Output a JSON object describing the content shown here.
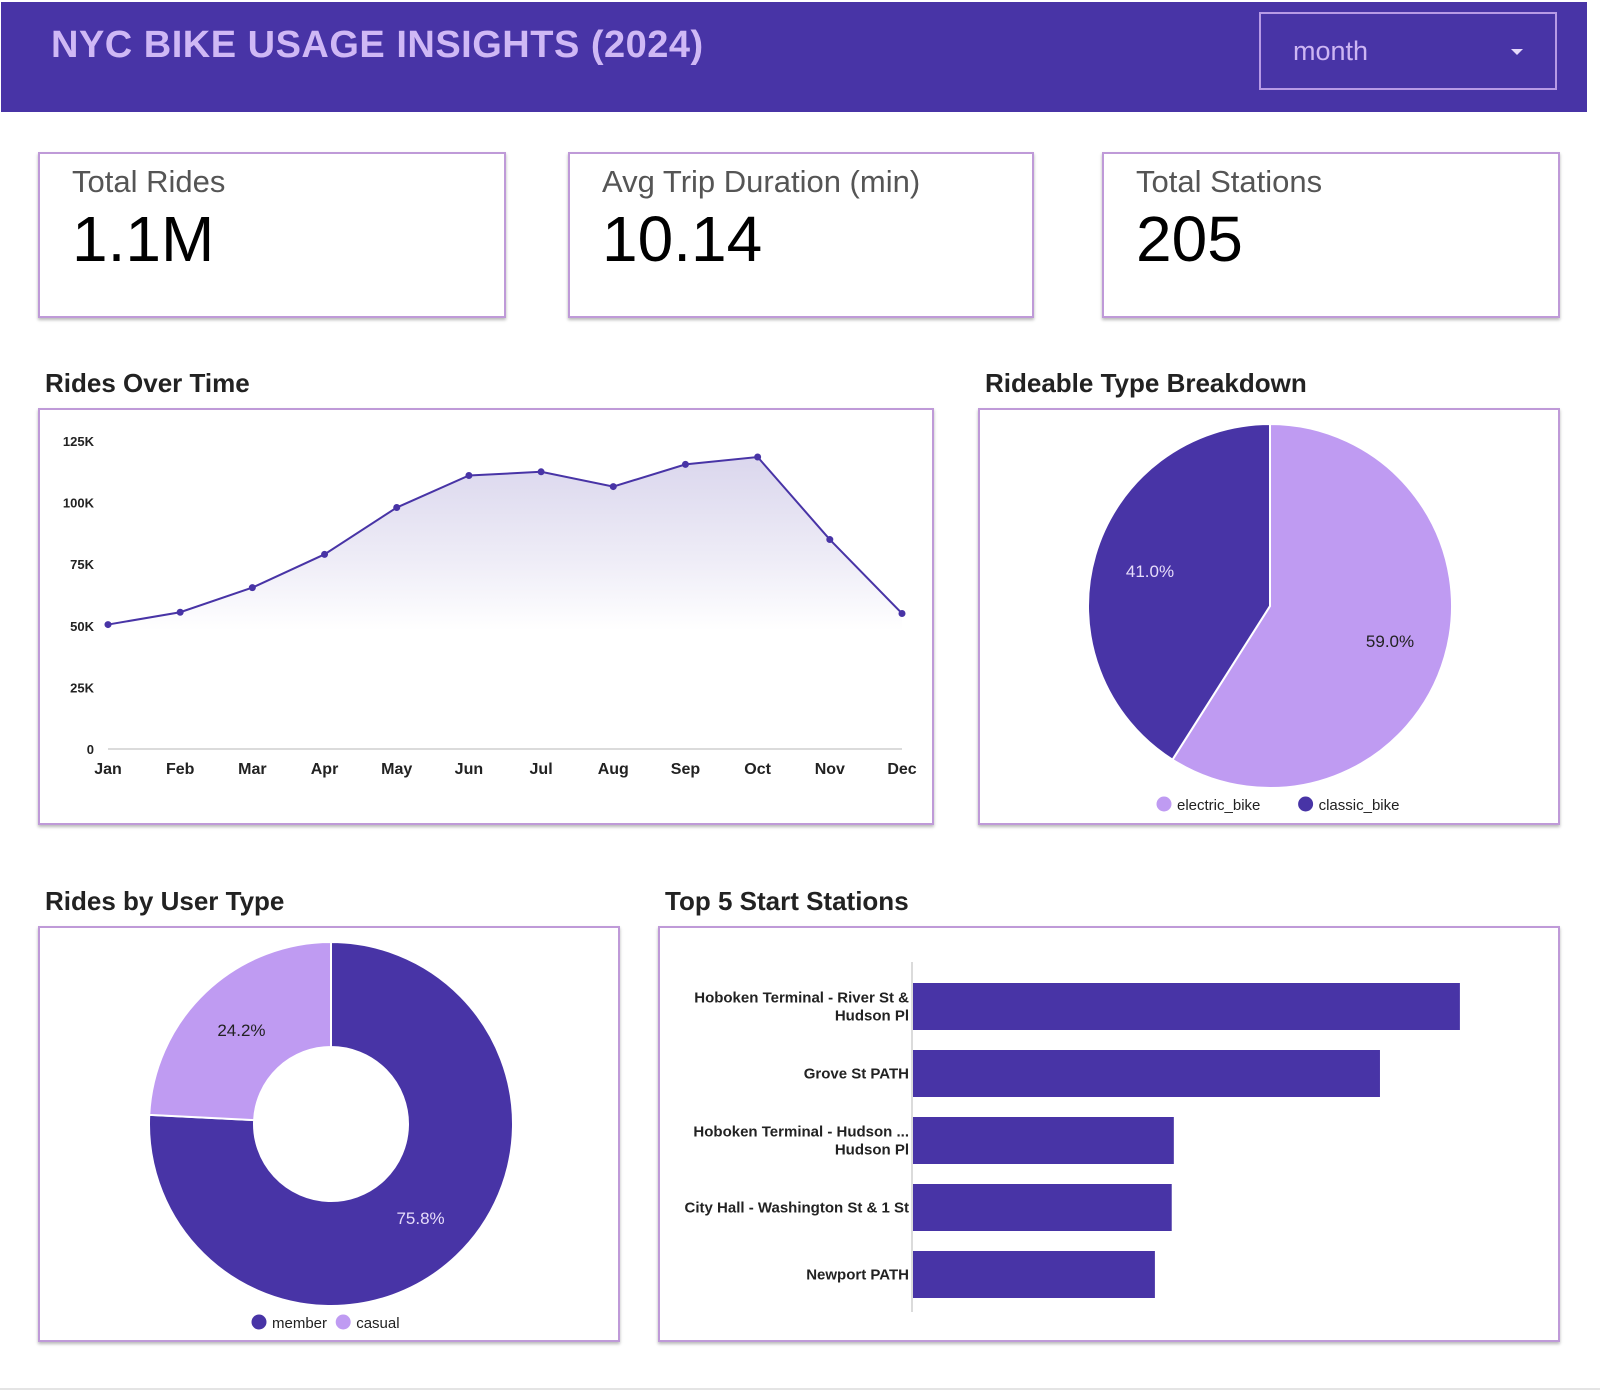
{
  "header": {
    "title": "NYC BIKE USAGE INSIGHTS (2024)",
    "period_select": {
      "value": "month"
    }
  },
  "kpis": [
    {
      "label": "Total Rides",
      "value": "1.1M"
    },
    {
      "label": "Avg Trip Duration (min)",
      "value": "10.14"
    },
    {
      "label": "Total Stations",
      "value": "205"
    }
  ],
  "sections": {
    "rides_over_time": "Rides Over Time",
    "rideable_type": "Rideable Type Breakdown",
    "user_type": "Rides by User Type",
    "top_stations": "Top 5 Start Stations"
  },
  "colors": {
    "primary": "#4834a6",
    "light": "#bf9bf2",
    "title_text": "#cfb8f5",
    "card_border": "#bf9ad8"
  },
  "chart_data": [
    {
      "type": "area",
      "title": "Rides Over Time",
      "categories": [
        "Jan",
        "Feb",
        "Mar",
        "Apr",
        "May",
        "Jun",
        "Jul",
        "Aug",
        "Sep",
        "Oct",
        "Nov",
        "Dec"
      ],
      "values": [
        50500,
        55500,
        65500,
        79000,
        98000,
        111000,
        112500,
        106500,
        115500,
        118500,
        85000,
        55000
      ],
      "ylim": [
        0,
        125000
      ],
      "yticks": [
        {
          "v": 0,
          "label": "0"
        },
        {
          "v": 25000,
          "label": "25K"
        },
        {
          "v": 50000,
          "label": "50K"
        },
        {
          "v": 75000,
          "label": "75K"
        },
        {
          "v": 100000,
          "label": "100K"
        },
        {
          "v": 125000,
          "label": "125K"
        }
      ],
      "grid": false
    },
    {
      "type": "pie",
      "title": "Rideable Type Breakdown",
      "slices": [
        {
          "name": "electric_bike",
          "value": 59.0,
          "label": "59.0%",
          "color": "#bf9bf2"
        },
        {
          "name": "classic_bike",
          "value": 41.0,
          "label": "41.0%",
          "color": "#4834a6"
        }
      ],
      "legend": "bottom"
    },
    {
      "type": "pie",
      "donut": true,
      "title": "Rides by User Type",
      "slices": [
        {
          "name": "member",
          "value": 75.8,
          "label": "75.8%",
          "color": "#4834a6"
        },
        {
          "name": "casual",
          "value": 24.2,
          "label": "24.2%",
          "color": "#bf9bf2"
        }
      ],
      "legend": "bottom"
    },
    {
      "type": "bar",
      "orientation": "horizontal",
      "title": "Top 5 Start Stations",
      "categories": [
        [
          "Hoboken Terminal - River St &",
          "Hudson Pl"
        ],
        [
          "Grove St PATH"
        ],
        [
          "Hoboken Terminal - Hudson ...",
          "Hudson Pl"
        ],
        [
          "City Hall - Washington St & 1 St"
        ],
        [
          "Newport PATH"
        ]
      ],
      "values": [
        26000,
        22200,
        12400,
        12300,
        11500
      ],
      "xlim": [
        0,
        29000
      ],
      "axis_labels_shown": false
    }
  ]
}
